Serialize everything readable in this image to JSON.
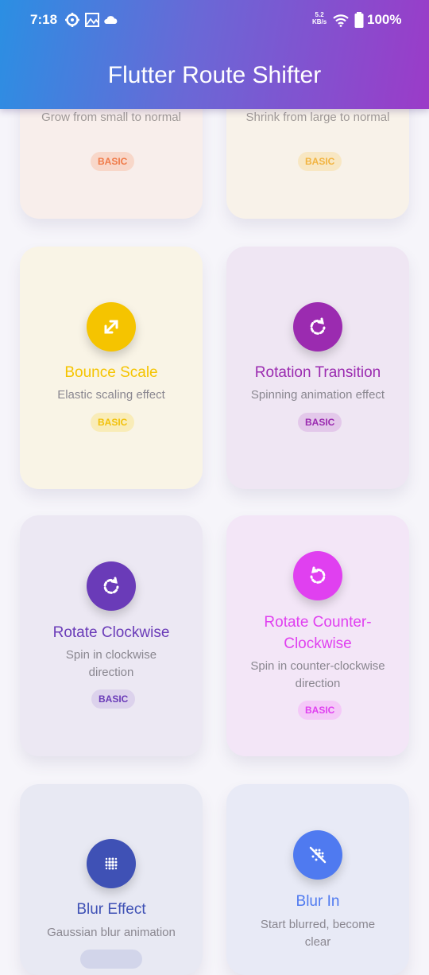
{
  "status_bar": {
    "time": "7:18",
    "speed_value": "5.2",
    "speed_unit": "KB/s",
    "battery": "100%",
    "icons": [
      "gear-icon",
      "gallery-icon",
      "cloud-icon",
      "wifi-icon",
      "battery-icon"
    ]
  },
  "app_bar": {
    "title": "Flutter Route Shifter"
  },
  "cards": [
    {
      "title": "",
      "desc": "Grow from small to normal",
      "badge": "BASIC",
      "color": "#f07a48",
      "icon": "scale-up-icon"
    },
    {
      "title": "",
      "desc": "Shrink from large to normal",
      "badge": "BASIC",
      "color": "#f2b441",
      "icon": "scale-down-icon"
    },
    {
      "title": "Bounce Scale",
      "desc": "Elastic scaling effect",
      "badge": "BASIC",
      "color": "#f5c400",
      "icon": "expand-icon"
    },
    {
      "title": "Rotation Transition",
      "desc": "Spinning animation effect",
      "badge": "BASIC",
      "color": "#9b2bb0",
      "icon": "rotate-icon"
    },
    {
      "title": "Rotate Clockwise",
      "desc": "Spin in clockwise direction",
      "badge": "BASIC",
      "color": "#6a3bb8",
      "icon": "rotate-clockwise-icon"
    },
    {
      "title": "Rotate Counter-Clockwise",
      "desc": "Spin in counter-clockwise direction",
      "badge": "BASIC",
      "color": "#e040f0",
      "icon": "rotate-counter-clockwise-icon"
    },
    {
      "title": "Blur Effect",
      "desc": "Gaussian blur animation",
      "badge": "",
      "color": "#3f51b5",
      "icon": "blur-icon"
    },
    {
      "title": "Blur In",
      "desc": "Start blurred, become clear",
      "badge": "",
      "color": "#4f7af0",
      "icon": "blur-off-icon"
    }
  ]
}
